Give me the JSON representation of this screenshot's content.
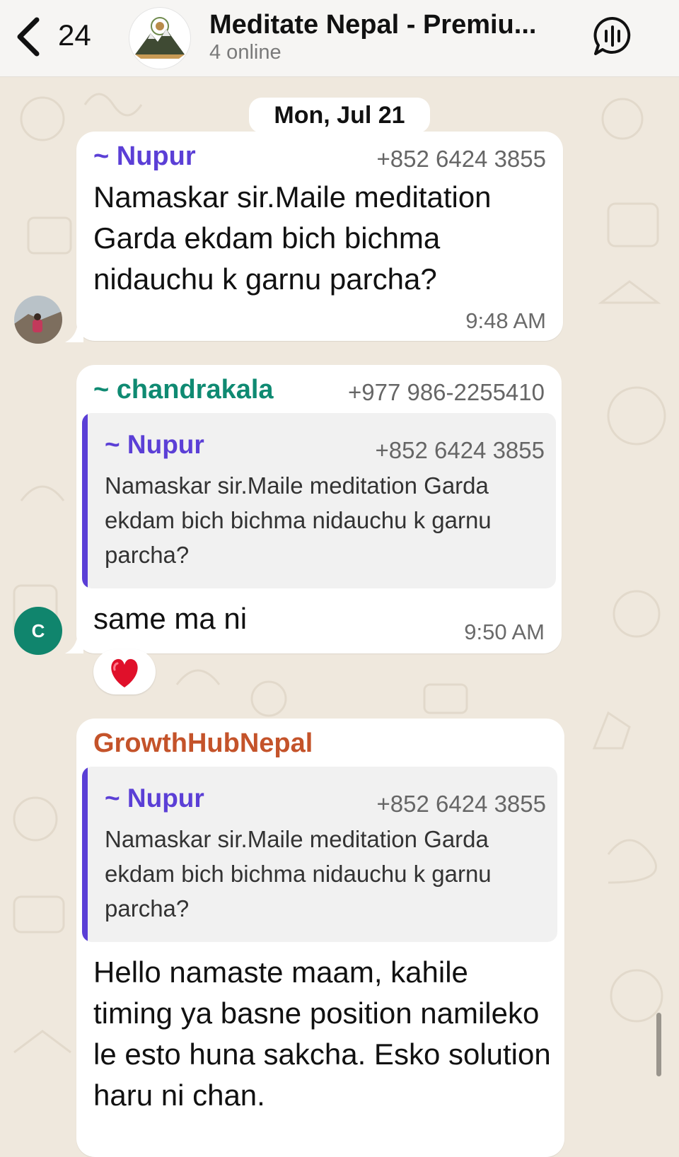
{
  "header": {
    "back_count": "24",
    "group_name": "Meditate Nepal - Premiu...",
    "group_status": "4 online",
    "logo_text": "~MEDITATE NEPAL~"
  },
  "date_separator": "Mon, Jul 21",
  "messages": [
    {
      "sender": "~ Nupur",
      "phone": "+852 6424 3855",
      "text": "Namaskar sir.Maile meditation Garda ekdam bich bichma nidauchu k garnu parcha?",
      "time": "9:48 AM"
    },
    {
      "sender": "~ chandrakala",
      "phone": "+977 986-2255410",
      "avatar_initial": "C",
      "quote": {
        "sender": "~ Nupur",
        "phone": "+852 6424 3855",
        "text": "Namaskar sir.Maile meditation Garda ekdam bich bichma nidauchu k garnu parcha?"
      },
      "text": "same ma ni",
      "time": "9:50 AM",
      "reaction": "❤️"
    },
    {
      "sender": "GrowthHubNepal",
      "quote": {
        "sender": "~ Nupur",
        "phone": "+852 6424 3855",
        "text": "Namaskar sir.Maile meditation Garda ekdam bich bichma nidauchu k garnu parcha?"
      },
      "text": "Hello namaste maam, kahile timing ya basne position namileko le esto huna sakcha. Esko solution haru ni chan."
    }
  ],
  "colors": {
    "nupur": "#5b3fd6",
    "chandrakala": "#0f8a72",
    "growthhub": "#c4532a",
    "wallpaper": "#efe8dd",
    "avatar_c": "#10856d"
  }
}
